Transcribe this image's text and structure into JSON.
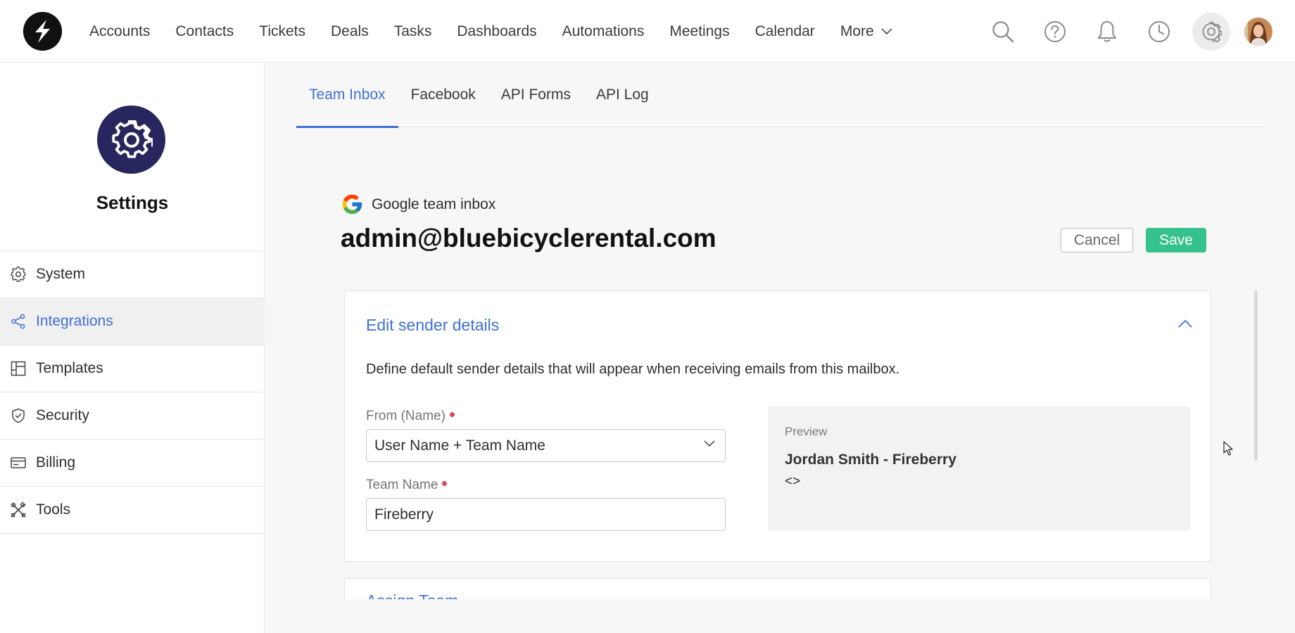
{
  "nav": {
    "items": [
      "Accounts",
      "Contacts",
      "Tickets",
      "Deals",
      "Tasks",
      "Dashboards",
      "Automations",
      "Meetings",
      "Calendar"
    ],
    "more_label": "More",
    "icons": [
      "search-icon",
      "help-icon",
      "bell-icon",
      "clock-icon",
      "gear-icon"
    ]
  },
  "sidebar": {
    "title": "Settings",
    "items": [
      {
        "label": "System",
        "icon": "gear-icon",
        "active": false
      },
      {
        "label": "Integrations",
        "icon": "share-icon",
        "active": true
      },
      {
        "label": "Templates",
        "icon": "template-icon",
        "active": false
      },
      {
        "label": "Security",
        "icon": "shield-icon",
        "active": false
      },
      {
        "label": "Billing",
        "icon": "billing-icon",
        "active": false
      },
      {
        "label": "Tools",
        "icon": "tools-icon",
        "active": false
      }
    ]
  },
  "tabs": [
    {
      "label": "Team Inbox",
      "active": true
    },
    {
      "label": "Facebook",
      "active": false
    },
    {
      "label": "API Forms",
      "active": false
    },
    {
      "label": "API Log",
      "active": false
    }
  ],
  "inbox": {
    "provider_label": "Google team inbox",
    "email": "admin@bluebicyclerental.com",
    "cancel_label": "Cancel",
    "save_label": "Save"
  },
  "sender": {
    "title": "Edit sender details",
    "description": "Define default sender details that will appear when receiving emails from this mailbox.",
    "from_label": "From (Name)",
    "from_value": "User Name + Team Name",
    "team_label": "Team Name",
    "team_value": "Fireberry",
    "preview_label": "Preview",
    "preview_name": "Jordan Smith - Fireberry",
    "preview_address": "<>"
  },
  "next_section": {
    "title": "Assign Team"
  },
  "colors": {
    "accent": "#3d6fd6",
    "save": "#35c28e",
    "settings_badge": "#27265e",
    "required": "#e0455b"
  }
}
